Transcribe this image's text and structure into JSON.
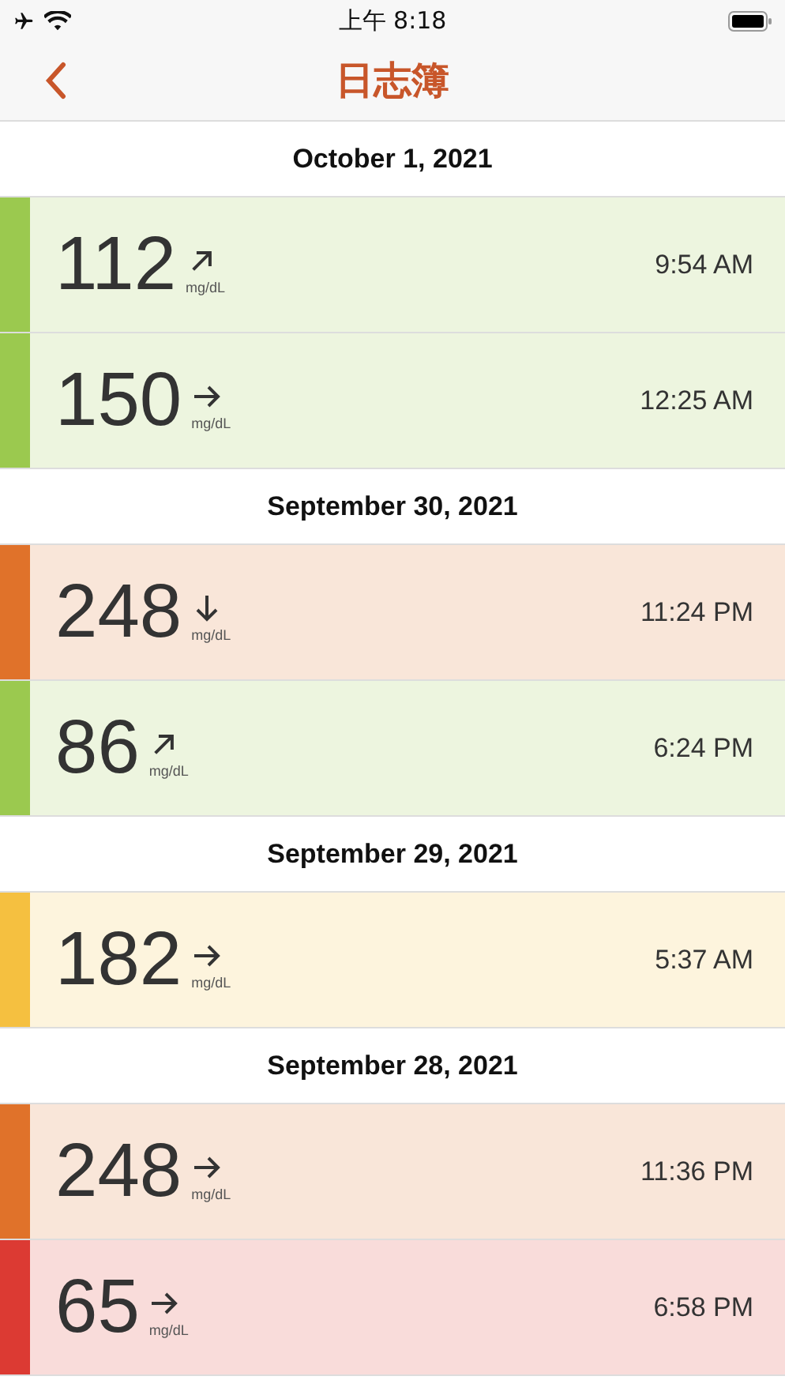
{
  "status_bar": {
    "time": "上午 8:18"
  },
  "nav": {
    "title": "日志簿"
  },
  "days": [
    {
      "date": "October 1, 2021",
      "readings": [
        {
          "value": "112",
          "unit": "mg/dL",
          "kind": "rising",
          "time": "9:54 AM",
          "color": "#9bc94f"
        },
        {
          "value": "150",
          "unit": "mg/dL",
          "kind": "steady",
          "time": "12:25 AM",
          "color": "#9bc94f"
        }
      ]
    },
    {
      "date": "September 30, 2021",
      "readings": [
        {
          "value": "248",
          "unit": "mg/dL",
          "kind": "falling",
          "time": "11:24 PM",
          "color": "#e0722a"
        },
        {
          "value": "86",
          "unit": "mg/dL",
          "kind": "rising",
          "time": "6:24 PM",
          "color": "#9bc94f"
        }
      ]
    },
    {
      "date": "September 29, 2021",
      "readings": [
        {
          "value": "182",
          "unit": "mg/dL",
          "kind": "steady",
          "time": "5:37 AM",
          "color": "#f5c040"
        }
      ]
    },
    {
      "date": "September 28, 2021",
      "readings": [
        {
          "value": "248",
          "unit": "mg/dL",
          "kind": "steady",
          "time": "11:36 PM",
          "color": "#e0722a"
        },
        {
          "value": "65",
          "unit": "mg/dL",
          "kind": "steady",
          "time": "6:58 PM",
          "color": "#dc3a33"
        }
      ]
    }
  ]
}
